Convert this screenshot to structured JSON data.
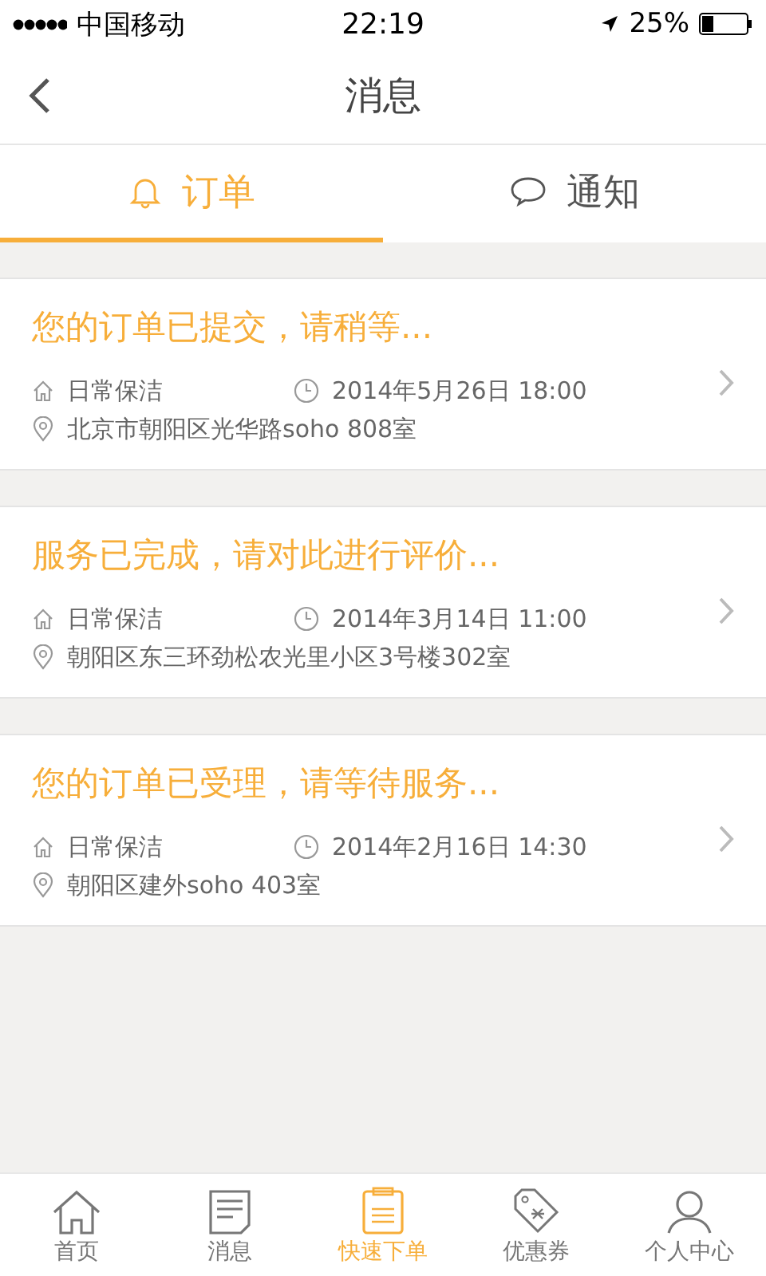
{
  "status_bar": {
    "carrier": "中国移动",
    "time": "22:19",
    "battery": "25%"
  },
  "nav": {
    "title": "消息"
  },
  "tabs": [
    {
      "label": "订单",
      "selected": true
    },
    {
      "label": "通知",
      "selected": false
    }
  ],
  "orders": [
    {
      "title": "您的订单已提交，请稍等...",
      "service": "日常保洁",
      "time": "2014年5月26日 18:00",
      "address": "北京市朝阳区光华路soho 808室"
    },
    {
      "title": "服务已完成，请对此进行评价...",
      "service": "日常保洁",
      "time": "2014年3月14日 11:00",
      "address": "朝阳区东三环劲松农光里小区3号楼302室"
    },
    {
      "title": "您的订单已受理，请等待服务...",
      "service": "日常保洁",
      "time": "2014年2月16日 14:30",
      "address": "朝阳区建外soho 403室"
    }
  ],
  "tab_bar": [
    {
      "label": "首页",
      "selected": false
    },
    {
      "label": "消息",
      "selected": false
    },
    {
      "label": "快速下单",
      "selected": true
    },
    {
      "label": "优惠券",
      "selected": false
    },
    {
      "label": "个人中心",
      "selected": false
    }
  ]
}
